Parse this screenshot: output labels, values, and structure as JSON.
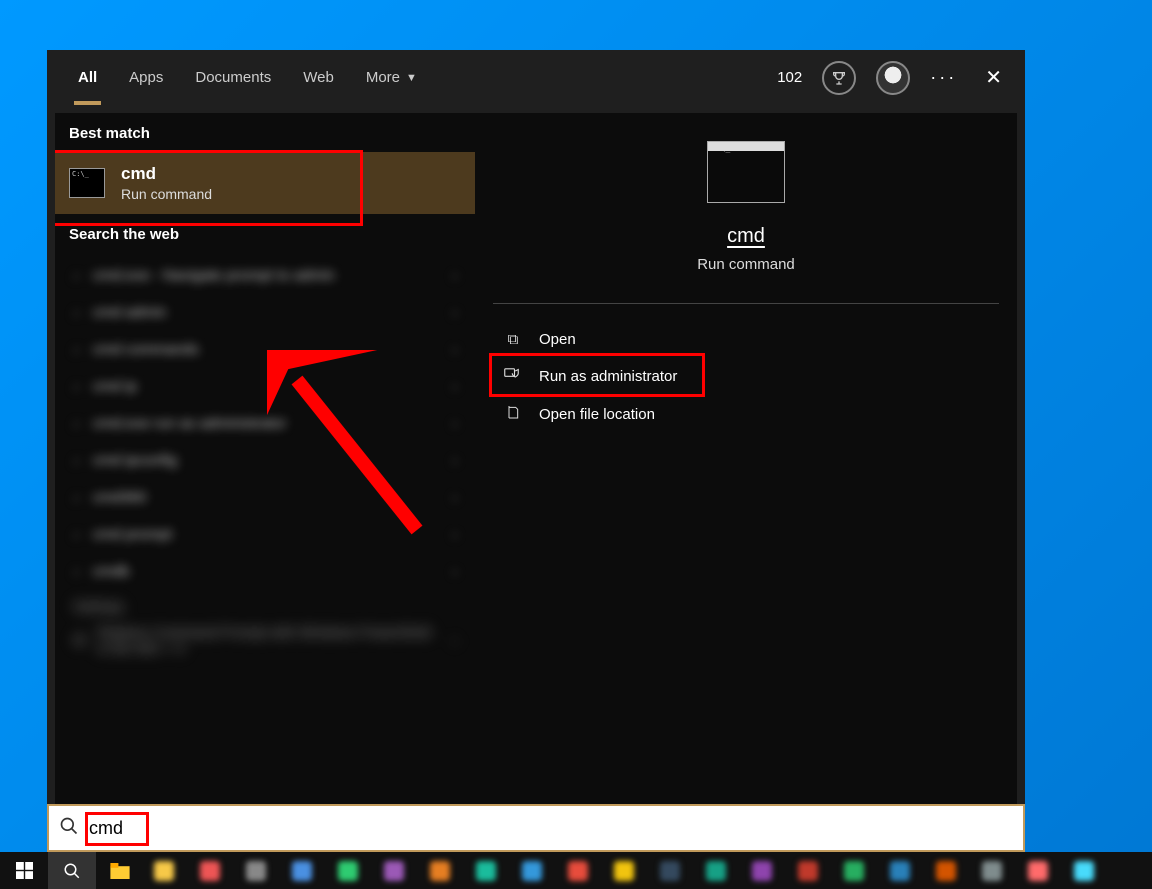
{
  "tabs": {
    "all": "All",
    "apps": "Apps",
    "documents": "Documents",
    "web": "Web",
    "more": "More"
  },
  "rewards": "102",
  "left": {
    "best_match_label": "Best match",
    "best_match": {
      "title": "cmd",
      "subtitle": "Run command"
    },
    "search_web_label": "Search the web",
    "web_items": [
      "cmd.exe - Navigate prompt to admin",
      "cmd admin",
      "cmd commands",
      "cmd ip",
      "cmd.exe run as administrator",
      "cmd ipconfig",
      "cmd360",
      "cmd prompt",
      "cmdb"
    ],
    "settings_label": "Settings",
    "settings_item": "Replace Command Prompt with Windows PowerShell in the Win + X"
  },
  "right": {
    "title": "cmd",
    "subtitle": "Run command",
    "actions": {
      "open": "Open",
      "admin": "Run as administrator",
      "location": "Open file location"
    }
  },
  "search_value": "cmd",
  "colors": {
    "highlight": "#ff0000",
    "accent": "#c19a5b"
  }
}
